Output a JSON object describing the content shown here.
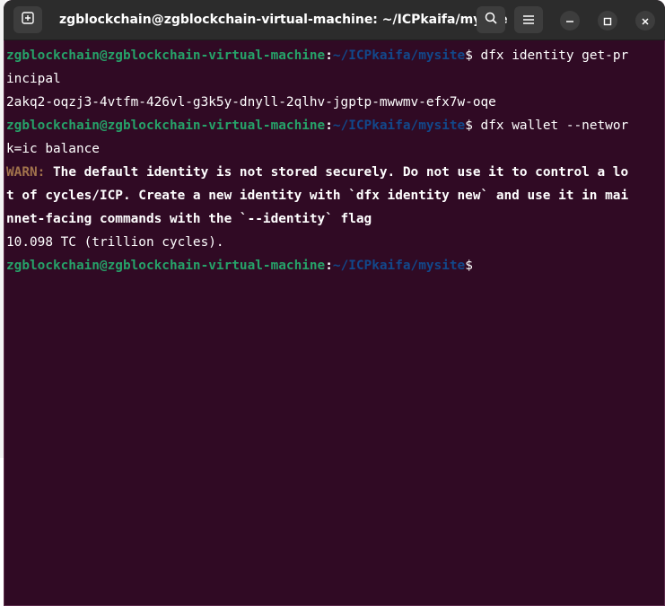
{
  "window": {
    "title": "zgblockchain@zgblockchain-virtual-machine: ~/ICPkaifa/mysite"
  },
  "icons": {
    "new_tab": "new-tab-icon",
    "search": "search-icon",
    "menu": "hamburger-menu-icon",
    "minimize": "minimize-icon",
    "maximize": "maximize-icon",
    "close": "close-icon"
  },
  "colors": {
    "background": "#300a24",
    "prompt_user": "#26a269",
    "prompt_path": "#12488b",
    "warn": "#a2734c",
    "titlebar": "#2c2c2c"
  },
  "terminal": {
    "lines": [
      {
        "user": "zgblockchain@zgblockchain-virtual-machine",
        "sep": ":",
        "path": "~/ICPkaifa/mysite",
        "dollar": "$",
        "cmd": " dfx identity get-pr"
      },
      {
        "text": "incipal"
      },
      {
        "text": "2akq2-oqzj3-4vtfm-426vl-g3k5y-dnyll-2qlhv-jgptp-mwwmv-efx7w-oqe"
      },
      {
        "user": "zgblockchain@zgblockchain-virtual-machine",
        "sep": ":",
        "path": "~/ICPkaifa/mysite",
        "dollar": "$",
        "cmd": " dfx wallet --networ"
      },
      {
        "text": "k=ic balance"
      },
      {
        "warn_label": "WARN:",
        "warn_text": " The default identity is not stored securely. Do not use it to control a lo"
      },
      {
        "bold_text": "t of cycles/ICP. Create a new identity with `dfx identity new` and use it in mai"
      },
      {
        "bold_text": "nnet-facing commands with the `--identity` flag"
      },
      {
        "text": "10.098 TC (trillion cycles)."
      },
      {
        "user": "zgblockchain@zgblockchain-virtual-machine",
        "sep": ":",
        "path": "~/ICPkaifa/mysite",
        "dollar": "$",
        "cmd": ""
      }
    ]
  }
}
